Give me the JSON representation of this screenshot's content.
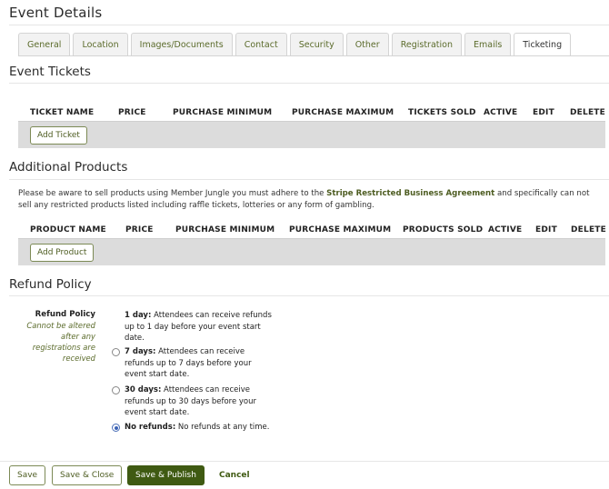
{
  "page": {
    "title": "Event Details"
  },
  "tabs": [
    {
      "label": "General"
    },
    {
      "label": "Location"
    },
    {
      "label": "Images/Documents"
    },
    {
      "label": "Contact"
    },
    {
      "label": "Security"
    },
    {
      "label": "Other"
    },
    {
      "label": "Registration"
    },
    {
      "label": "Emails"
    },
    {
      "label": "Ticketing",
      "active": true
    }
  ],
  "tickets": {
    "heading": "Event Tickets",
    "columns": [
      "TICKET NAME",
      "PRICE",
      "PURCHASE MINIMUM",
      "PURCHASE MAXIMUM",
      "TICKETS SOLD",
      "ACTIVE",
      "EDIT",
      "DELETE"
    ],
    "add_label": "Add Ticket"
  },
  "products": {
    "heading": "Additional Products",
    "note_before": "Please be aware to sell products using Member Jungle you must adhere to the ",
    "note_link": "Stripe Restricted Business Agreement",
    "note_after": " and specifically can not sell any restricted products listed including raffle tickets, lotteries or any form of gambling.",
    "columns": [
      "PRODUCT NAME",
      "PRICE",
      "PURCHASE MINIMUM",
      "PURCHASE MAXIMUM",
      "PRODUCTS SOLD",
      "ACTIVE",
      "EDIT",
      "DELETE"
    ],
    "add_label": "Add Product"
  },
  "refund": {
    "heading": "Refund Policy",
    "label": "Refund Policy",
    "hint": "Cannot be altered after any registrations are received",
    "options": [
      {
        "title": "1 day:",
        "text": " Attendees can receive refunds up to 1 day before your event start date.",
        "has_radio": false,
        "selected": false
      },
      {
        "title": "7 days:",
        "text": " Attendees can receive refunds up to 7 days before your event start date.",
        "has_radio": true,
        "selected": false
      },
      {
        "title": "30 days:",
        "text": " Attendees can receive refunds up to 30 days before your event start date.",
        "has_radio": true,
        "selected": false
      },
      {
        "title": "No refunds:",
        "text": " No refunds at any time.",
        "has_radio": true,
        "selected": true
      }
    ]
  },
  "footer": {
    "save": "Save",
    "save_close": "Save & Close",
    "save_publish": "Save & Publish",
    "cancel": "Cancel"
  },
  "colors": {
    "accent": "#3f5a12",
    "link": "#4e5d22",
    "band": "#dcdcdc"
  }
}
